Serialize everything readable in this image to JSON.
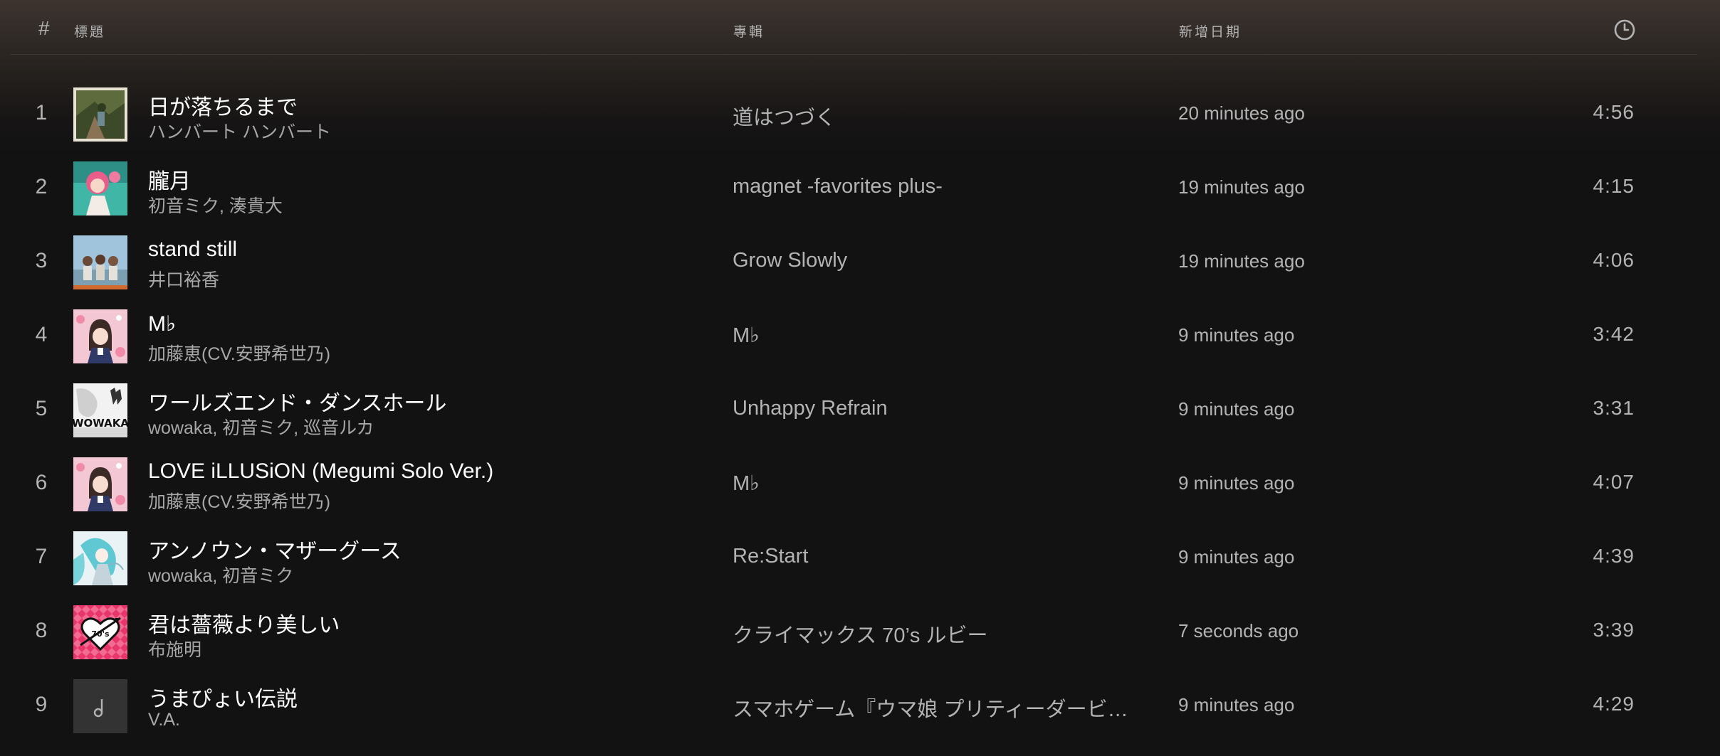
{
  "header": {
    "num_label": "#",
    "title_label": "標題",
    "album_label": "專輯",
    "date_label": "新增日期",
    "duration_icon": "clock-icon"
  },
  "tracks": [
    {
      "num": "1",
      "title": "日が落ちるまで",
      "artist": "ハンバート ハンバート",
      "album": "道はつづく",
      "added": "20 minutes ago",
      "duration": "4:56"
    },
    {
      "num": "2",
      "title": "朧月",
      "artist": "初音ミク, 湊貴大",
      "album": "magnet -favorites plus-",
      "added": "19 minutes ago",
      "duration": "4:15"
    },
    {
      "num": "3",
      "title": "stand still",
      "artist": "井口裕香",
      "album": "Grow Slowly",
      "added": "19 minutes ago",
      "duration": "4:06"
    },
    {
      "num": "4",
      "title": "M♭",
      "artist": "加藤恵(CV.安野希世乃)",
      "album": "M♭",
      "added": "9 minutes ago",
      "duration": "3:42"
    },
    {
      "num": "5",
      "title": "ワールズエンド・ダンスホール",
      "artist": "wowaka, 初音ミク, 巡音ルカ",
      "album": "Unhappy Refrain",
      "added": "9 minutes ago",
      "duration": "3:31"
    },
    {
      "num": "6",
      "title": "LOVE iLLUSiON (Megumi Solo Ver.)",
      "artist": "加藤恵(CV.安野希世乃)",
      "album": "M♭",
      "added": "9 minutes ago",
      "duration": "4:07"
    },
    {
      "num": "7",
      "title": "アンノウン・マザーグース",
      "artist": "wowaka, 初音ミク",
      "album": "Re:Start",
      "added": "9 minutes ago",
      "duration": "4:39"
    },
    {
      "num": "8",
      "title": "君は薔薇より美しい",
      "artist": "布施明",
      "album": "クライマックス 70’s ルビー",
      "added": "7 seconds ago",
      "duration": "3:39"
    },
    {
      "num": "9",
      "title": "うまぴょい伝説",
      "artist": "V.A.",
      "album": "スマホゲーム『ウマ娘 プリティーダービー』",
      "added": "9 minutes ago",
      "duration": "4:29"
    }
  ],
  "artwork_text": {
    "wowaka": "WOWAKA",
    "ruby_badge": "70's"
  },
  "colors": {
    "background": "#121212",
    "header_gradient_top": "#3d3430",
    "primary_text": "#ffffff",
    "secondary_text": "#b3b3b3"
  }
}
